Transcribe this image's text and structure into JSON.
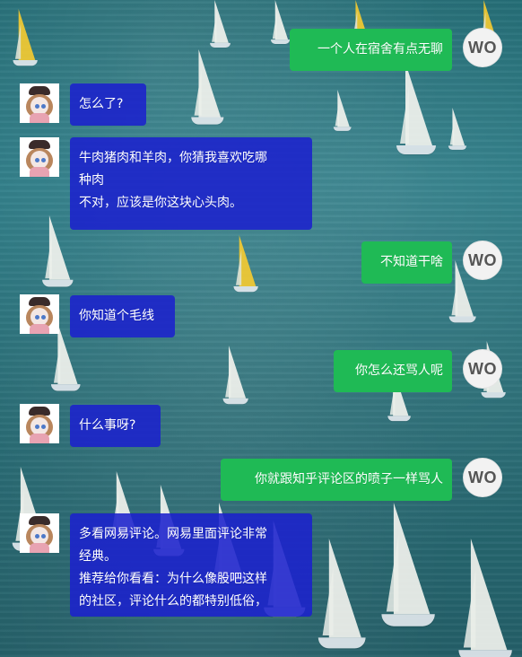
{
  "colors": {
    "user_bubble": "#1fba55",
    "bot_bubble": "#1b21cd",
    "text": "#ffffff"
  },
  "avatars": {
    "user_label": "WO",
    "bot_icon": "anime-girl-avatar-icon"
  },
  "messages": [
    {
      "sender": "user",
      "text": "一个人在宿舍有点无聊"
    },
    {
      "sender": "bot",
      "text": "怎么了?"
    },
    {
      "sender": "bot",
      "text": "牛肉猪肉和羊肉，你猜我喜欢吃哪\n种肉\n不对，应该是你这块心头肉。"
    },
    {
      "sender": "user",
      "text": "不知道干啥"
    },
    {
      "sender": "bot",
      "text": "你知道个毛线"
    },
    {
      "sender": "user",
      "text": "你怎么还骂人呢"
    },
    {
      "sender": "bot",
      "text": "什么事呀?"
    },
    {
      "sender": "user",
      "text": "你就跟知乎评论区的喷子一样骂人"
    },
    {
      "sender": "bot",
      "text": "多看网易评论。网易里面评论非常\n经典。\n推荐给你看看：为什么像股吧这样\n的社区，评论什么的都特别低俗，"
    }
  ]
}
